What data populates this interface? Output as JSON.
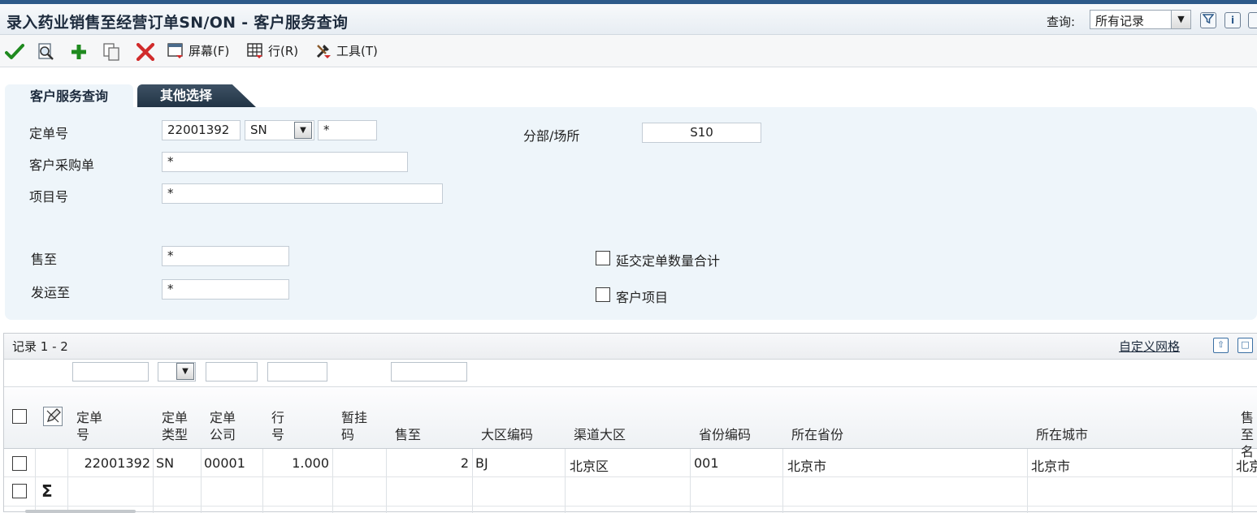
{
  "window": {
    "title": "录入药业销售至经营订单SN/ON - 客户服务查询",
    "query_label": "查询:",
    "query_value": "所有记录"
  },
  "toolbar": {
    "screen_label": "屏幕(F)",
    "row_label": "行(R)",
    "tools_label": "工具(T)"
  },
  "tabs": [
    {
      "label": "客户服务查询",
      "active": true
    },
    {
      "label": "其他选择",
      "active": false
    }
  ],
  "form": {
    "order_no_label": "定单号",
    "order_no_value": "22001392",
    "order_type_value": "SN",
    "order_company_value": "*",
    "branch_label": "分部/场所",
    "branch_value": "S10",
    "customer_po_label": "客户采购单",
    "customer_po_value": "*",
    "item_no_label": "项目号",
    "item_no_value": "*",
    "sold_to_label": "售至",
    "sold_to_value": "*",
    "ship_to_label": "发运至",
    "ship_to_value": "*",
    "backorder_total_label": "延交定单数量合计",
    "customer_item_label": "客户项目"
  },
  "grid": {
    "records_label": "记录 1 - 2",
    "customize_label": "自定义网格",
    "columns": [
      {
        "line1": "定单",
        "line2": "号"
      },
      {
        "line1": "定单",
        "line2": "类型"
      },
      {
        "line1": "定单",
        "line2": "公司"
      },
      {
        "line1": "行",
        "line2": "号"
      },
      {
        "line1": "暂挂",
        "line2": "码"
      },
      {
        "line1": "",
        "line2": "售至"
      },
      {
        "line1": "",
        "line2": "大区编码"
      },
      {
        "line1": "",
        "line2": "渠道大区"
      },
      {
        "line1": "",
        "line2": "省份编码"
      },
      {
        "line1": "",
        "line2": "所在省份"
      },
      {
        "line1": "",
        "line2": "所在城市"
      },
      {
        "line1": "售至",
        "line2": "名"
      }
    ],
    "rows": [
      {
        "order_no": "22001392",
        "order_type": "SN",
        "order_company": "00001",
        "line_no": "1.000",
        "hold_code": "",
        "sold_to": "2",
        "region_code": "BJ",
        "channel_region": "北京区",
        "province_code": "001",
        "province": "北京市",
        "city": "北京市",
        "sold_to_name": "北京"
      }
    ],
    "sum_symbol": "Σ"
  },
  "colors": {
    "accent": "#2d5a8a",
    "form_bg": "#eef5fa",
    "tab_dark": "#2b3e50",
    "check_green": "#1f8a1f",
    "delete_red": "#d12b2b"
  }
}
